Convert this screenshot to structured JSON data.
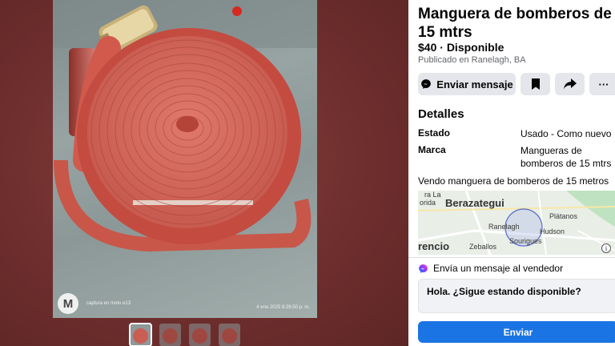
{
  "photo": {
    "caption": "captura en moto e13",
    "date": "4 ene 2025 8:26:50 p. m.",
    "logo_icon": "motorola-logo-icon"
  },
  "thumbnails": [
    {
      "name": "thumbnail-1",
      "active": true
    },
    {
      "name": "thumbnail-2",
      "active": false
    },
    {
      "name": "thumbnail-3",
      "active": false
    },
    {
      "name": "thumbnail-4",
      "active": false
    }
  ],
  "listing": {
    "title": "Manguera de bomberos de 15 mtrs",
    "price": "$40",
    "separator": " · ",
    "status": "Disponible",
    "location": "Publicado en Ranelagh, BA"
  },
  "actions": {
    "message_label": "Enviar mensaje",
    "message_icon": "messenger-icon",
    "save_icon": "bookmark-icon",
    "share_icon": "share-icon",
    "more_icon": "more-icon",
    "more_glyph": "···"
  },
  "details": {
    "title": "Detalles",
    "rows": [
      {
        "label": "Estado",
        "value": "Usado - Como nuevo"
      },
      {
        "label": "Marca",
        "value": "Mangueras de bomberos de 15 mtrs"
      }
    ],
    "description": "Vendo manguera de bomberos de 15 metros"
  },
  "map": {
    "labels": [
      "Berazategui",
      "Ranelagh",
      "Plátanos",
      "Hudson",
      "Sourigues",
      "Zeballos",
      "rencio",
      "ra La",
      "orida"
    ],
    "info_glyph": "i"
  },
  "message": {
    "seller_prompt": "Envía un mensaje al vendedor",
    "seller_icon": "messenger-icon",
    "draft": "Hola. ¿Sigue estando disponible?",
    "send_label": "Enviar"
  },
  "colors": {
    "accent": "#1b74e4",
    "backdrop": "#6e2f2e",
    "button_bg": "#e4e6eb"
  }
}
